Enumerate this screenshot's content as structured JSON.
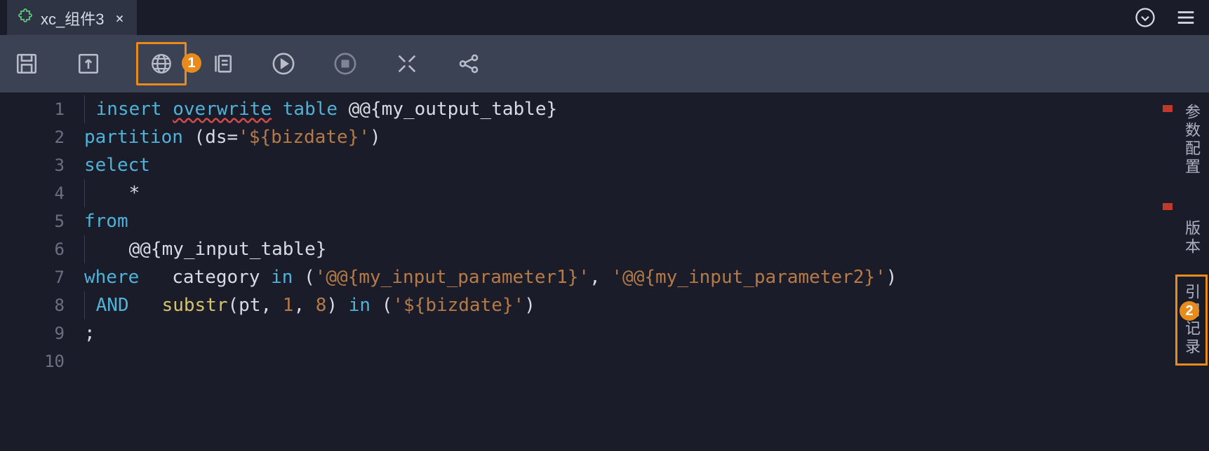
{
  "tab": {
    "icon": "puzzle-icon",
    "label": "xc_组件3"
  },
  "header_icons": {
    "dropdown": "chevron-circle-down-icon",
    "menu": "hamburger-icon"
  },
  "toolbar": {
    "save": "save-icon",
    "upload": "upload-icon",
    "globe": "globe-icon",
    "params": "params-icon",
    "run": "play-icon",
    "stop": "stop-icon",
    "tools": "tools-icon",
    "share": "share-icon"
  },
  "callouts": {
    "one": "1",
    "two": "2"
  },
  "code_lines": [
    {
      "n": 1,
      "tokens": [
        {
          "t": "indent"
        },
        {
          "t": "kw",
          "v": "insert"
        },
        {
          "t": "sp"
        },
        {
          "t": "wavy",
          "v": "overwrite"
        },
        {
          "t": "sp"
        },
        {
          "t": "kw",
          "v": "table"
        },
        {
          "t": "sp"
        },
        {
          "t": "plain",
          "v": "@@{my_output_table}"
        }
      ]
    },
    {
      "n": 2,
      "tokens": [
        {
          "t": "kw",
          "v": "partition"
        },
        {
          "t": "sp"
        },
        {
          "t": "plain",
          "v": "(ds="
        },
        {
          "t": "str",
          "v": "'${bizdate}'"
        },
        {
          "t": "plain",
          "v": ")"
        }
      ]
    },
    {
      "n": 3,
      "tokens": [
        {
          "t": "kw",
          "v": "select"
        }
      ]
    },
    {
      "n": 4,
      "tokens": [
        {
          "t": "indent"
        },
        {
          "t": "plain",
          "v": "   *"
        }
      ]
    },
    {
      "n": 5,
      "tokens": [
        {
          "t": "kw",
          "v": "from"
        }
      ]
    },
    {
      "n": 6,
      "tokens": [
        {
          "t": "indent"
        },
        {
          "t": "plain",
          "v": "   @@{my_input_table}"
        }
      ]
    },
    {
      "n": 7,
      "tokens": [
        {
          "t": "kw",
          "v": "where"
        },
        {
          "t": "plain",
          "v": "   category "
        },
        {
          "t": "kw",
          "v": "in"
        },
        {
          "t": "plain",
          "v": " ("
        },
        {
          "t": "str",
          "v": "'@@{my_input_parameter1}'"
        },
        {
          "t": "plain",
          "v": ", "
        },
        {
          "t": "str",
          "v": "'@@{my_input_parameter2}'"
        },
        {
          "t": "plain",
          "v": ")"
        }
      ]
    },
    {
      "n": 8,
      "tokens": [
        {
          "t": "indent"
        },
        {
          "t": "kw",
          "v": "AND"
        },
        {
          "t": "plain",
          "v": "   "
        },
        {
          "t": "func",
          "v": "substr"
        },
        {
          "t": "plain",
          "v": "(pt, "
        },
        {
          "t": "str",
          "v": "1"
        },
        {
          "t": "plain",
          "v": ", "
        },
        {
          "t": "str",
          "v": "8"
        },
        {
          "t": "plain",
          "v": ") "
        },
        {
          "t": "kw",
          "v": "in"
        },
        {
          "t": "plain",
          "v": " ("
        },
        {
          "t": "str",
          "v": "'${bizdate}'"
        },
        {
          "t": "plain",
          "v": ")"
        }
      ]
    },
    {
      "n": 9,
      "tokens": [
        {
          "t": "plain",
          "v": ";"
        }
      ]
    },
    {
      "n": 10,
      "tokens": []
    }
  ],
  "right_rail": {
    "params_config": "参数配置",
    "version": "版本",
    "reference_log": "引用记录"
  }
}
